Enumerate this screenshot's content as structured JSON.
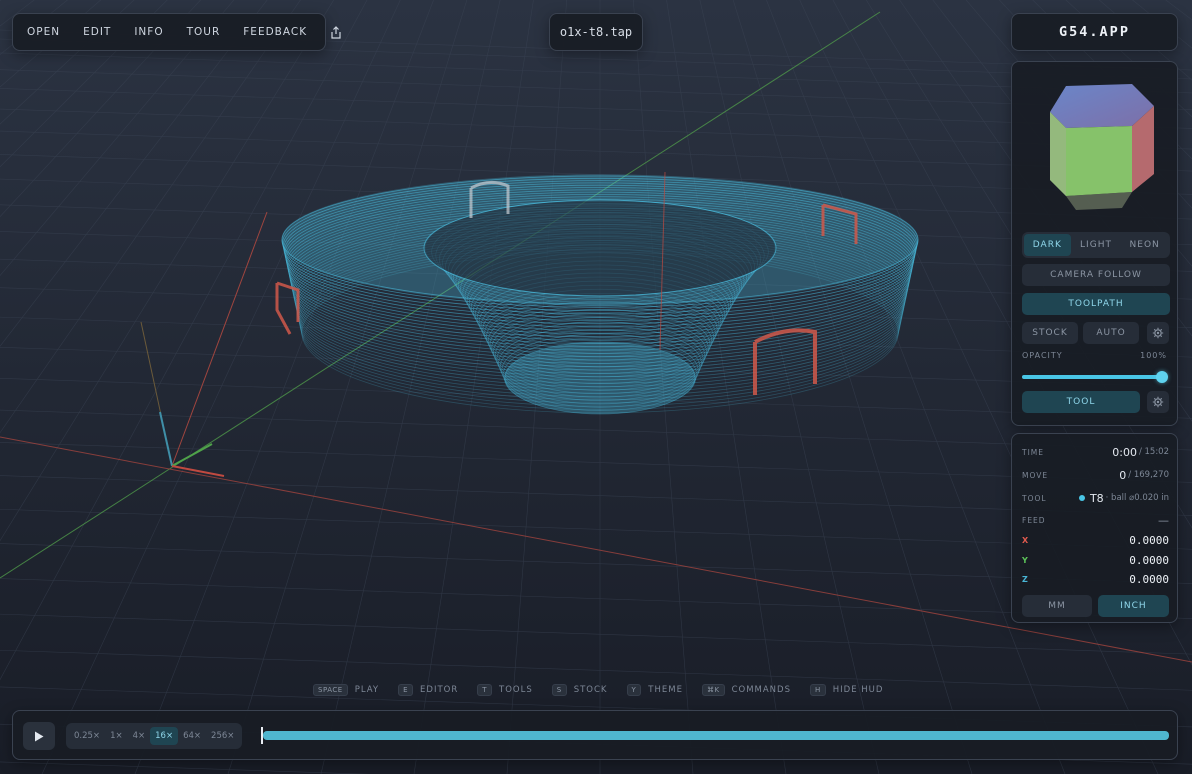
{
  "menu": {
    "items": [
      "OPEN",
      "EDIT",
      "INFO",
      "TOUR",
      "FEEDBACK"
    ],
    "share_icon": "share-icon"
  },
  "file": {
    "name": "o1x-t8.tap"
  },
  "brand": {
    "name": "G54.APP"
  },
  "controls": {
    "theme_options": [
      "DARK",
      "LIGHT",
      "NEON"
    ],
    "theme_selected": "DARK",
    "camera_follow": "CAMERA FOLLOW",
    "toolpath": "TOOLPATH",
    "stock": "STOCK",
    "auto": "AUTO",
    "opacity_label": "OPACITY",
    "opacity_value": "100%",
    "opacity_fraction": 1.0,
    "tool": "TOOL"
  },
  "status": {
    "time_label": "TIME",
    "time_value": "0:00",
    "time_total": "/ 15:02",
    "move_label": "MOVE",
    "move_value": "0",
    "move_total": "/ 169,270",
    "tool_label": "TOOL",
    "tool_value": "T8",
    "tool_desc": "· ball ⌀0.020 in",
    "feed_label": "FEED",
    "feed_value": "—",
    "x_label": "X",
    "x_value": "0.0000",
    "y_label": "Y",
    "y_value": "0.0000",
    "z_label": "Z",
    "z_value": "0.0000",
    "units": [
      "MM",
      "INCH"
    ],
    "unit_selected": "INCH"
  },
  "hints": [
    {
      "key": "SPACE",
      "label": "PLAY"
    },
    {
      "key": "E",
      "label": "EDITOR"
    },
    {
      "key": "T",
      "label": "TOOLS"
    },
    {
      "key": "S",
      "label": "STOCK"
    },
    {
      "key": "Y",
      "label": "THEME"
    },
    {
      "key": "⌘K",
      "label": "COMMANDS"
    },
    {
      "key": "H",
      "label": "HIDE HUD"
    }
  ],
  "timeline": {
    "speeds": [
      "0.25×",
      "1×",
      "4×",
      "16×",
      "64×",
      "256×"
    ],
    "speed_selected": "16×",
    "progress": 0
  },
  "colors": {
    "accent": "#49c6e6",
    "toolpath": "#4cc7ea",
    "x_axis": "#e05a4e",
    "y_axis": "#5cc45a",
    "z_axis": "#49b6d6"
  }
}
